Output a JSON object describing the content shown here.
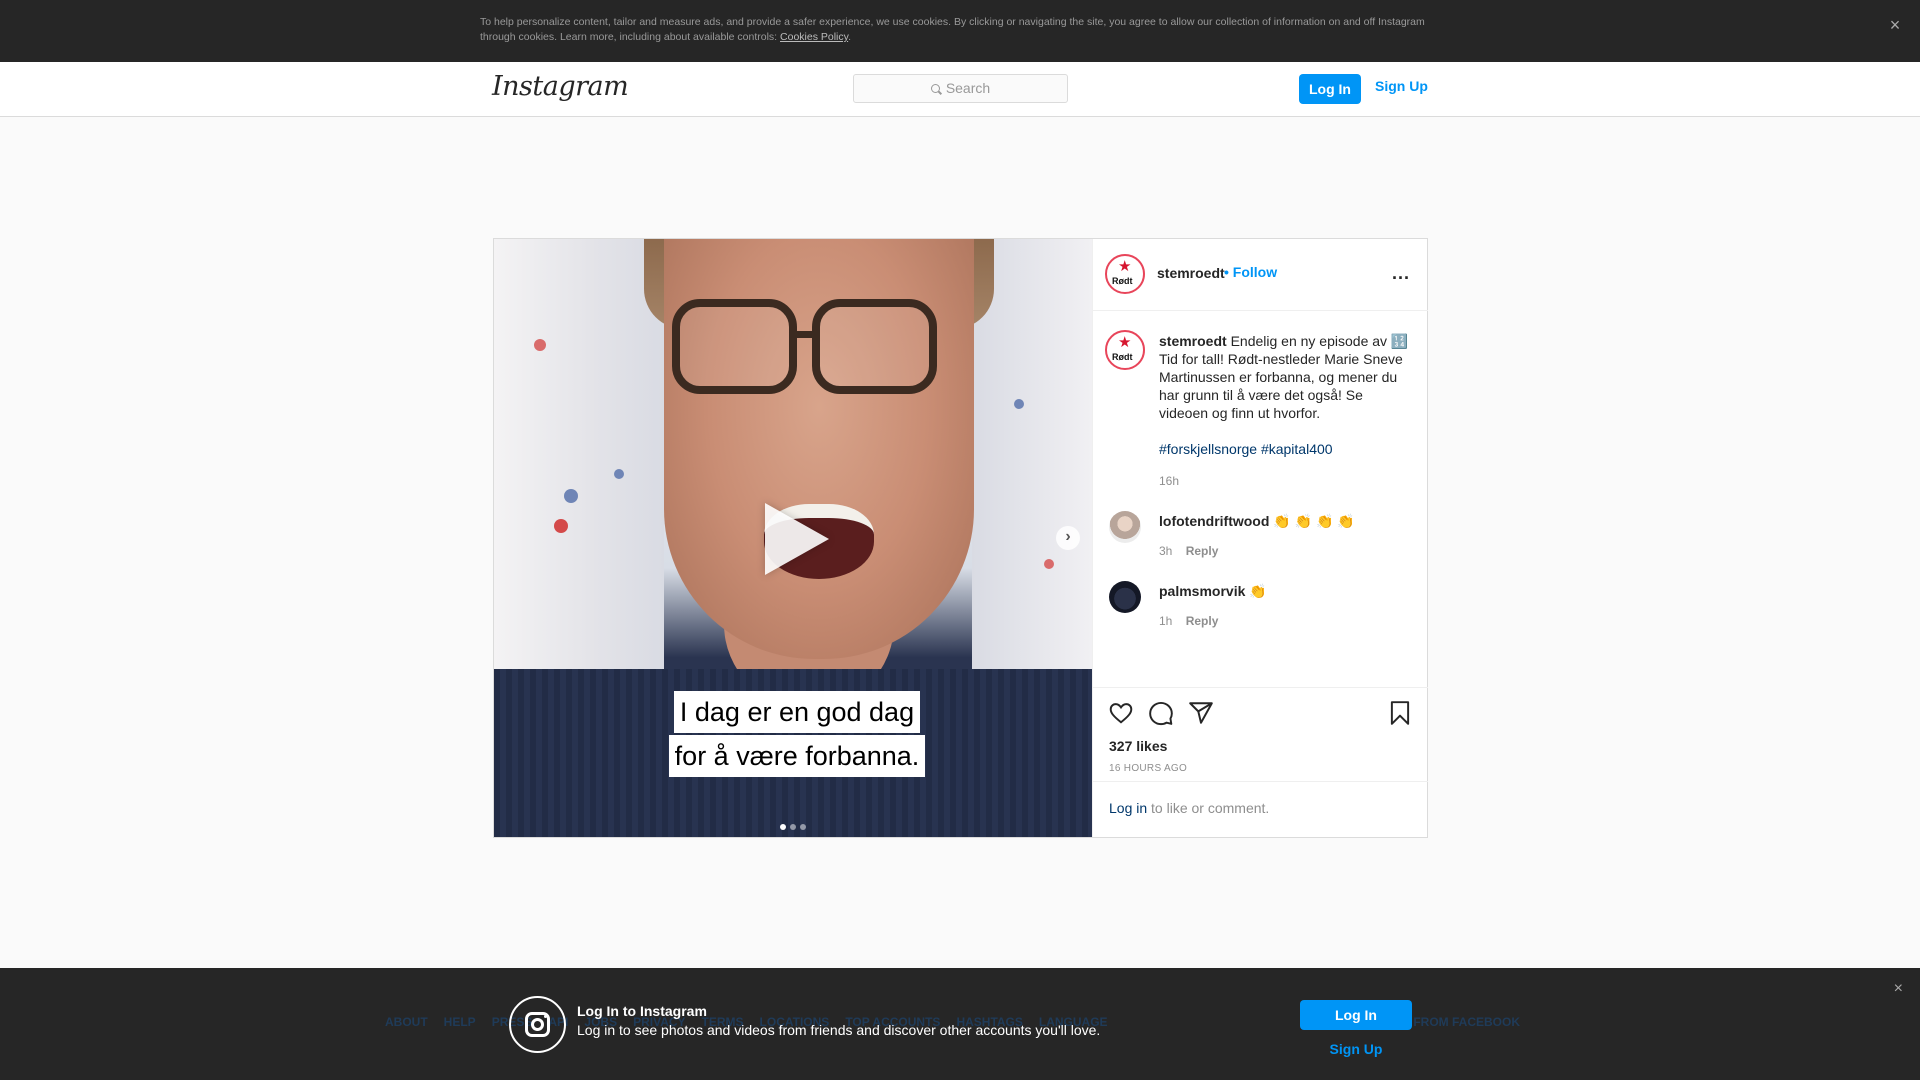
{
  "cookie_banner": {
    "text": "To help personalize content, tailor and measure ads, and provide a safer experience, we use cookies. By clicking or navigating the site, you agree to allow our collection of information on and off Instagram through cookies. Learn more, including about available controls:",
    "policy_link": "Cookies Policy",
    "policy_suffix": ".",
    "close_icon": "×"
  },
  "header": {
    "logo": "Instagram",
    "search_placeholder": "Search",
    "login_label": "Log In",
    "signup_label": "Sign Up"
  },
  "post": {
    "username": "stemroedt",
    "follow_label": "• Follow",
    "more_label": "...",
    "avatar_text": "Rødt",
    "avatar_star": "★",
    "caption": "Endelig en ny episode av 🔢 Tid for tall! Rødt-nestleder Marie Sneve Martinussen er forbanna, og mener du har grunn til å være det også! Se videoen og finn ut hvorfor.",
    "hashtags": "#forskjellsnorge #kapital400",
    "caption_time": "16h",
    "video_subtitle_line1": "I dag er en god dag",
    "video_subtitle_line2": "for å være forbanna.",
    "next_icon": "›",
    "comments": [
      {
        "user": "lofotendriftwood",
        "text": "👏 👏 👏 👏",
        "time": "3h",
        "reply": "Reply"
      },
      {
        "user": "palmsmorvik",
        "text": "👏",
        "time": "1h",
        "reply": "Reply"
      }
    ],
    "likes": "327 likes",
    "time_ago": "16 HOURS AGO",
    "login_link": "Log in",
    "login_suffix": " to like or comment."
  },
  "footer": {
    "links": [
      "ABOUT",
      "HELP",
      "PRESS",
      "API",
      "JOBS",
      "PRIVACY",
      "TERMS",
      "LOCATIONS",
      "TOP ACCOUNTS",
      "HASHTAGS",
      "LANGUAGE"
    ],
    "right_text": "M FROM FACEBOOK"
  },
  "login_prompt": {
    "title": "Log In to Instagram",
    "subtitle": "Log in to see photos and videos from friends and discover other accounts you'll love.",
    "login_label": "Log In",
    "signup_label": "Sign Up",
    "close_icon": "×"
  },
  "colors": {
    "accent": "#0095f6",
    "banner_bg": "#262626",
    "brand_red": "#d6162f"
  }
}
